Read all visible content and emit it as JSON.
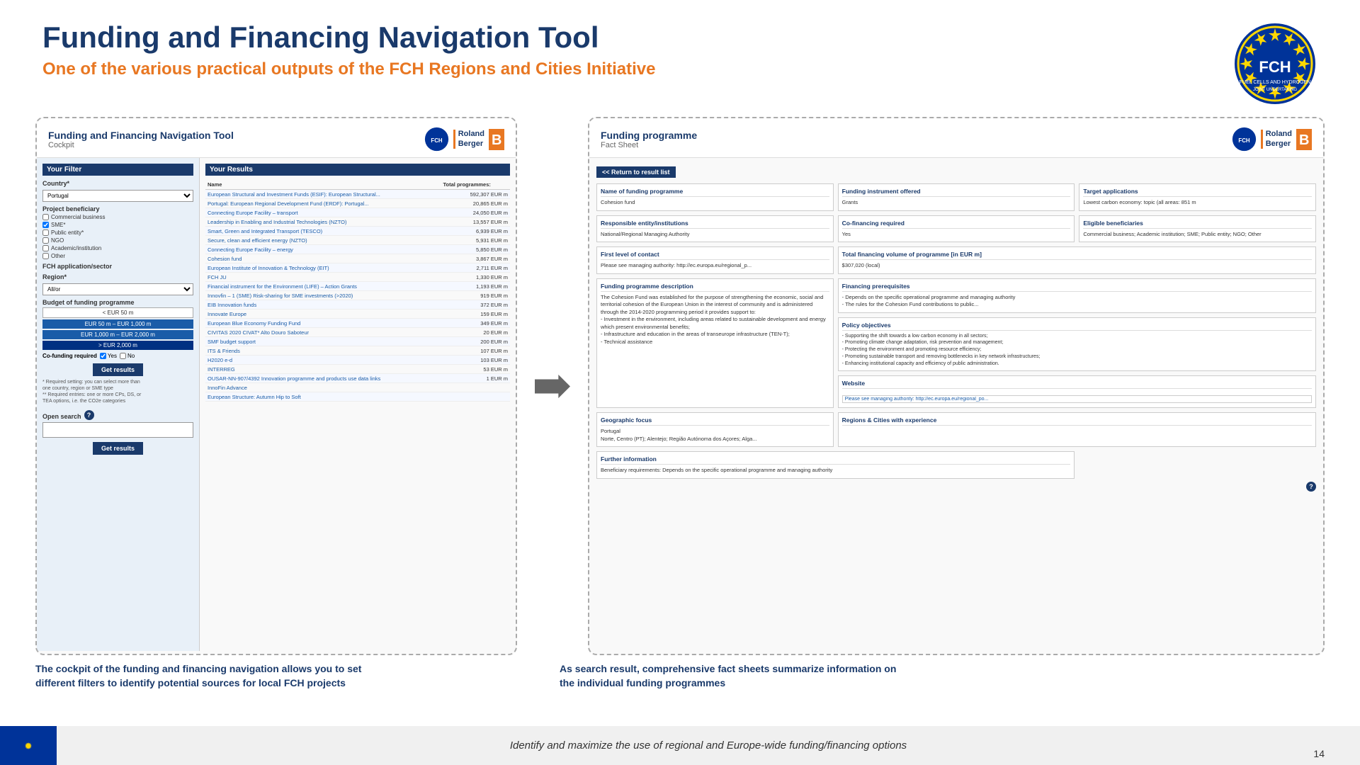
{
  "header": {
    "main_title": "Funding and Financing Navigation Tool",
    "sub_title": "One of the various practical outputs of the FCH Regions and Cities Initiative"
  },
  "left_panel": {
    "title": "Funding and Financing Navigation Tool",
    "subtitle": "Cockpit",
    "filter_section_title": "Your Filter",
    "country_label": "Country*",
    "country_value": "Portugal",
    "project_beneficiary_label": "Project beneficiary",
    "beneficiaries": [
      "Commercial business",
      "SME*",
      "Public entity*",
      "NGO",
      "Academic/institution",
      "Other"
    ],
    "fch_application_label": "FCH application/sector",
    "region_label": "Region*",
    "budget_label": "Budget of funding programme",
    "budget_options": [
      "< EUR 50 m",
      "EUR 50 m – EUR 1,000 m",
      "EUR 1,000 m – EUR 2,000 m",
      "> EUR 2,000 m"
    ],
    "cofunding_label": "Co-funding required",
    "cofunding_yes": "Yes",
    "cofunding_no": "No",
    "get_results_btn": "Get results",
    "filter_notes": "* Required setting: you can select more than\none country, region or SME type\n** Required entries: one or more CPs, DS, or\nTEA options, i.e. the CO2e categories",
    "open_search_label": "Open search",
    "open_search_placeholder": "",
    "get_results_btn2": "Get results"
  },
  "results_section": {
    "title": "Your Results",
    "col_name": "Name",
    "col_total": "Total programmes:",
    "items": [
      {
        "name": "European Structural and Investment Funds (ESIF): European Structural...",
        "value": "592,307 EUR m"
      },
      {
        "name": "Portugal: European Regional Development Fund (ERDF): Portugal...",
        "value": "20,865 EUR m"
      },
      {
        "name": "Connecting Europe Facility – transport",
        "value": "24,050 EUR m"
      },
      {
        "name": "Leadership in Enabling and Industrial Technologies (NZTO)",
        "value": "13,557 EUR m"
      },
      {
        "name": "Smart, Green and Integrated Transport (TESCO)",
        "value": "6,939 EUR m"
      },
      {
        "name": "Secure, clean and efficient energy (NZTO)",
        "value": "5,931 EUR m"
      },
      {
        "name": "Connecting Europe Facility – energy",
        "value": "5,850 EUR m"
      },
      {
        "name": "Cohesion fund",
        "value": "3,867 EUR m"
      },
      {
        "name": "European Institute of Innovation & Technology (EIT)",
        "value": "2,711 EUR m"
      },
      {
        "name": "FCH JU",
        "value": "1,330 EUR m"
      },
      {
        "name": "Financial instrument for the Environment (LIFE) – Action Grants",
        "value": "1,193 EUR m"
      },
      {
        "name": "Innovfin – 1 (SME) Risk-sharing for SME investments (>2020)",
        "value": "919 EUR m"
      },
      {
        "name": "EIB Innovation funds",
        "value": "372 EUR m"
      },
      {
        "name": "Innovate Europe",
        "value": "159 EUR m"
      },
      {
        "name": "European Blue Economy Funding Fund",
        "value": "349 EUR m"
      },
      {
        "name": "CIVITAS 2020 CIVAT* Alto Douro Saboteur",
        "value": "20 EUR m"
      },
      {
        "name": "SMF budget support",
        "value": "200 EUR m"
      },
      {
        "name": "ITS & Friends",
        "value": "107 EUR m"
      },
      {
        "name": "H2020 e-d",
        "value": "103 EUR m"
      },
      {
        "name": "INTERREG",
        "value": "53 EUR m"
      },
      {
        "name": "OUSAR-NN-907/4392 Innovation programme and products use data links",
        "value": "1 EUR m"
      },
      {
        "name": "InnoFin Advance",
        "value": ""
      },
      {
        "name": "European Structure: Autumn Hip to Soft",
        "value": ""
      }
    ]
  },
  "factsheet_panel": {
    "title": "Funding programme",
    "subtitle": "Fact Sheet",
    "return_btn": "<< Return to result list",
    "fields": {
      "name_label": "Name of funding programme",
      "name_value": "Cohesion fund",
      "responsible_label": "Responsible entity/institutions",
      "responsible_value": "National/Regional Managing Authority",
      "first_contact_label": "First level of contact",
      "first_contact_value": "Please see managing authority: http://ec.europa.eu/regional_p...",
      "description_label": "Funding programme description",
      "description_value": "The Cohesion Fund was established for the purpose of strengthening the economic, social and territorial cohesion of the European Union in the interest of community and is administered through the 2014-2020 programming period it provides support to:\n- Investment in the environment, including areas related to sustainable development and energy which present environmental benefits;\n- Infrastructure and education in the areas of transeurope infrastructure (TEN-T);\n- Technical assistance",
      "instrument_label": "Funding instrument offered",
      "instrument_value": "Grants",
      "cofinancing_label": "Co-financing required",
      "cofinancing_value": "Yes",
      "total_volume_label": "Total financing volume of programme [in EUR m]",
      "total_volume_value": "$307,020 (local)",
      "prerequisites_label": "Financing prerequisites",
      "prerequisites_value": "- Depends on the specific operational programme and managing authority\n- The rules for the Cohesion Fund contributions to public...",
      "website_label": "Website",
      "website_value": "Please see managing authority: http://ec.europa.eu/regional_po...",
      "further_info_label": "Further information",
      "further_info_value": "Beneficiary requirements: Depends on the specific operational programme and managing authority",
      "geographic_label": "Geographic focus",
      "geographic_value": "Portugal",
      "geographic_sub": "Norte, Centro (PT); Alentejo; Região Autónoma dos Açores; Alga...",
      "regions_label": "Regions & Cities with experience",
      "regions_value": "",
      "policy_label": "Policy objectives",
      "policy_value": "- Supporting the shift towards a low carbon economy in all sectors;\n- Promoting climate change adaptation, risk prevention and management;\n- Protecting the environment and promoting resource efficiency;\n- Promoting sustainable transport and removing bottlenecks in key network infrastructures;\n- Enhancing institutional capacity and efficiency of public administration.",
      "target_label": "Target applications",
      "target_value": "Lowest carbon economy: topic (all areas: 851 m",
      "eligible_label": "Eligible beneficiaries",
      "eligible_value": "Commercial business; Academic institution; SME; Public entity; NGO; Other"
    }
  },
  "bottom": {
    "left_text": "The cockpit of the funding and financing navigation allows you to set\ndifferent filters to identify potential sources for local FCH projects",
    "right_text": "As search result, comprehensive fact sheets summarize information on\nthe individual funding programmes"
  },
  "footer": {
    "text": "Identify and maximize the use of regional and Europe-wide funding/financing options",
    "page": "14"
  }
}
